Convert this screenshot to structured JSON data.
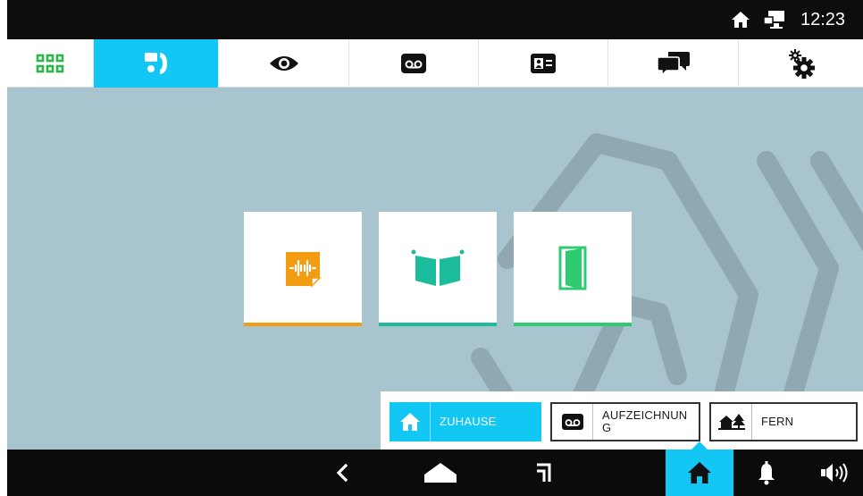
{
  "status_bar": {
    "time": "12:23",
    "icons": [
      "home-icon",
      "monitor-icon"
    ]
  },
  "tabs": [
    {
      "name": "apps",
      "icon": "apps-grid-icon",
      "active": false
    },
    {
      "name": "intercom",
      "icon": "intercom-handset-icon",
      "active": true
    },
    {
      "name": "camera",
      "icon": "eye-icon",
      "active": false
    },
    {
      "name": "recordings",
      "icon": "voicemail-icon",
      "active": false
    },
    {
      "name": "contacts",
      "icon": "contact-card-icon",
      "active": false
    },
    {
      "name": "messages",
      "icon": "chat-bubbles-icon",
      "active": false
    },
    {
      "name": "settings",
      "icon": "gears-icon",
      "active": false
    }
  ],
  "tiles": [
    {
      "icon": "audio-note-icon",
      "color": "#f39c12"
    },
    {
      "icon": "open-gate-icon",
      "color": "#1abc9c"
    },
    {
      "icon": "open-door-icon",
      "color": "#2ecc71"
    }
  ],
  "modes": {
    "home": {
      "label": "ZUHAUSE",
      "icon": "house-icon",
      "active": true
    },
    "recording": {
      "label": "AUFZEICHNUN\nG",
      "icon": "voicemail-icon",
      "active": false
    },
    "away": {
      "label": "FERN",
      "icon": "house-tree-icon",
      "active": false
    }
  },
  "colors": {
    "accent": "#12c7f4",
    "background": "#a7c4cf",
    "apps_green": "#2db54b"
  },
  "navbar": {
    "buttons": [
      "back-icon",
      "home-button-icon",
      "recent-apps-icon",
      "home-mode-icon",
      "bell-icon",
      "volume-icon"
    ]
  }
}
